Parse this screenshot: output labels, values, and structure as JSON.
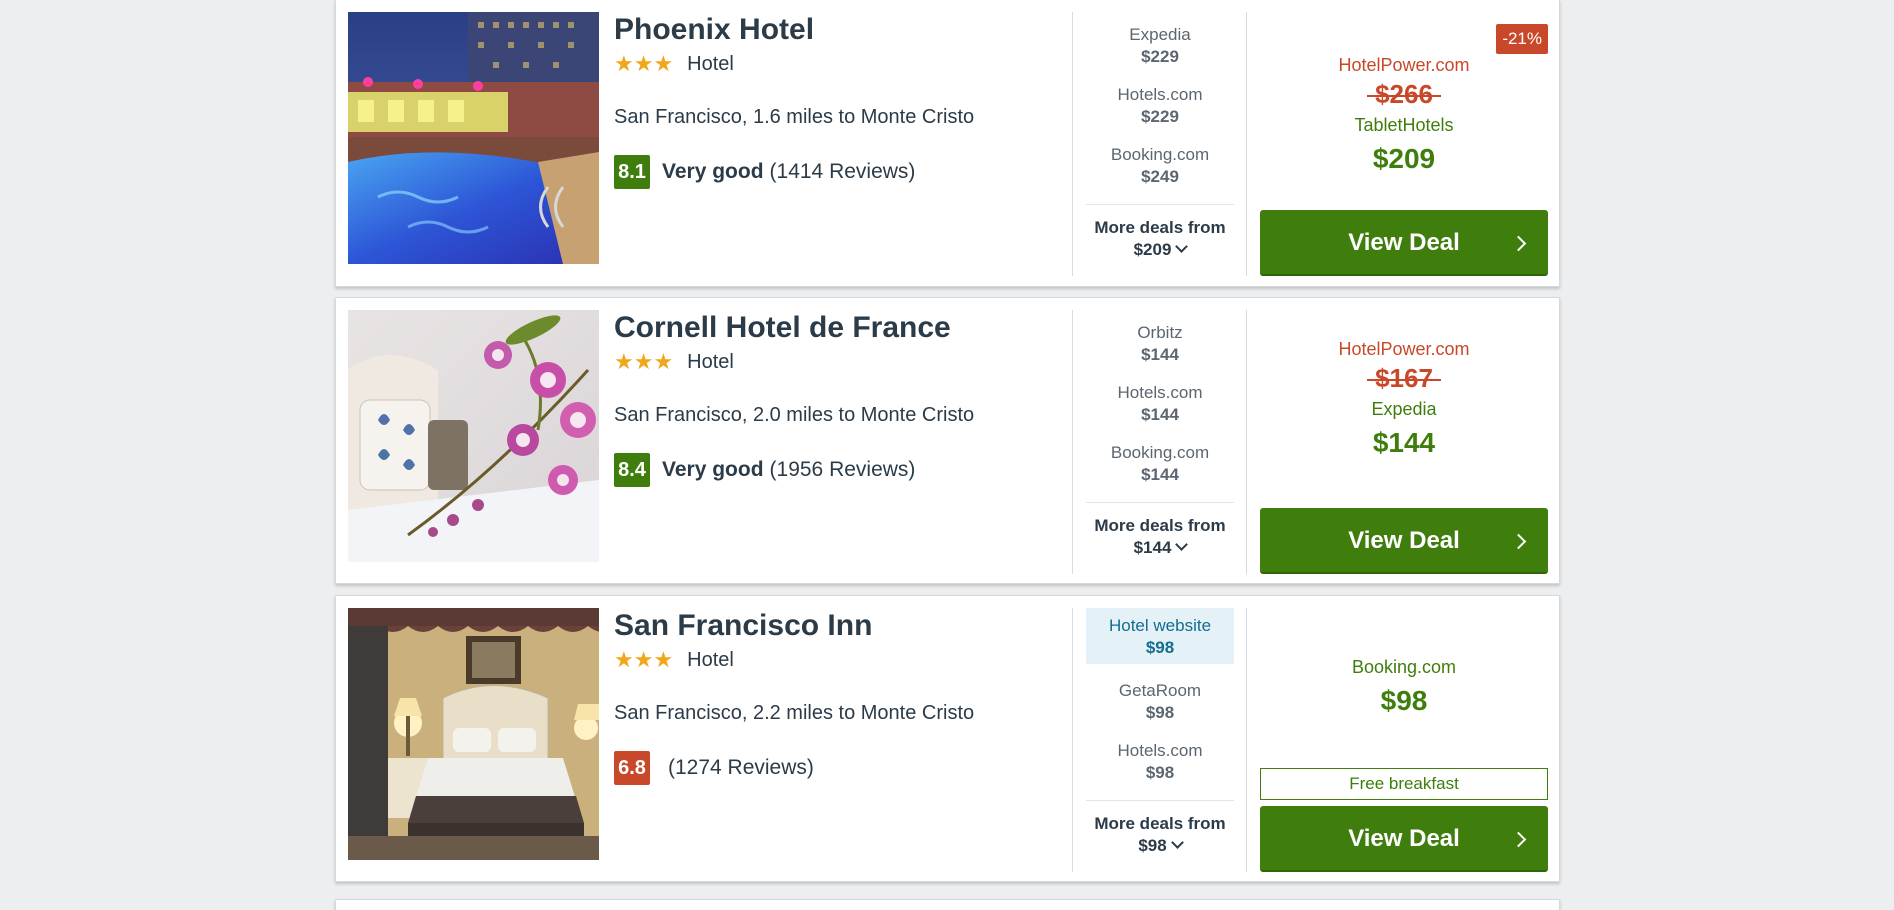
{
  "colors": {
    "accent_green": "#3f7e0d",
    "discount_red": "#c9482a",
    "star_orange": "#f1a71b",
    "highlight_blue": "#126d91"
  },
  "hotels": [
    {
      "name": "Phoenix Hotel",
      "stars": "★★★",
      "type": "Hotel",
      "location": "San Francisco, 1.6 miles to Monte Cristo",
      "score": "8.1",
      "rating_label": "Very good",
      "reviews": "(1414 Reviews)",
      "providers": [
        {
          "name": "Expedia",
          "price": "$229"
        },
        {
          "name": "Hotels.com",
          "price": "$229"
        },
        {
          "name": "Booking.com",
          "price": "$249"
        }
      ],
      "more_deals_label": "More deals from",
      "more_deals_price": "$209",
      "discount_badge": "-21%",
      "old_provider": "HotelPower.com",
      "old_price": "$266",
      "best_provider": "TabletHotels",
      "best_price": "$209",
      "button_label": "View Deal"
    },
    {
      "name": "Cornell Hotel de France",
      "stars": "★★★",
      "type": "Hotel",
      "location": "San Francisco, 2.0 miles to Monte Cristo",
      "score": "8.4",
      "rating_label": "Very good",
      "reviews": "(1956 Reviews)",
      "providers": [
        {
          "name": "Orbitz",
          "price": "$144"
        },
        {
          "name": "Hotels.com",
          "price": "$144"
        },
        {
          "name": "Booking.com",
          "price": "$144"
        }
      ],
      "more_deals_label": "More deals from",
      "more_deals_price": "$144",
      "old_provider": "HotelPower.com",
      "old_price": "$167",
      "best_provider": "Expedia",
      "best_price": "$144",
      "button_label": "View Deal"
    },
    {
      "name": "San Francisco Inn",
      "stars": "★★★",
      "type": "Hotel",
      "location": "San Francisco, 2.2 miles to Monte Cristo",
      "score": "6.8",
      "reviews": "(1274 Reviews)",
      "providers": [
        {
          "name": "Hotel website",
          "price": "$98"
        },
        {
          "name": "GetaRoom",
          "price": "$98"
        },
        {
          "name": "Hotels.com",
          "price": "$98"
        }
      ],
      "more_deals_label": "More deals from",
      "more_deals_price": "$98",
      "best_provider": "Booking.com",
      "best_price": "$98",
      "perk": "Free breakfast",
      "button_label": "View Deal"
    }
  ]
}
